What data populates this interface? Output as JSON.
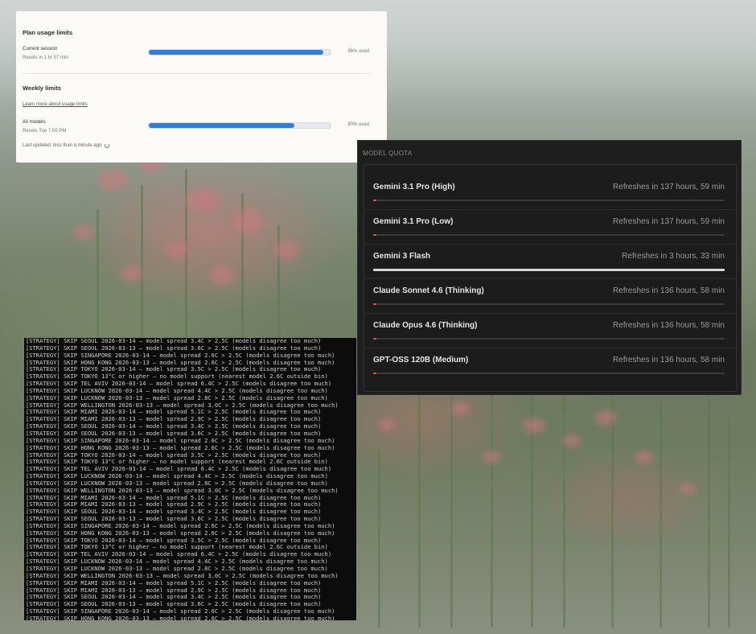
{
  "plan_usage": {
    "title": "Plan usage limits",
    "current_session": {
      "label": "Current session",
      "reset": "Resets in 1 hr 57 min",
      "percent": 96,
      "percent_text": "96% used"
    },
    "weekly_title": "Weekly limits",
    "learn_more": "Learn more about usage limits",
    "all_models": {
      "label": "All models",
      "reset": "Resets Tue 7:00 PM",
      "percent": 80,
      "percent_text": "80% used"
    },
    "last_updated": "Last updated: less than a minute ago",
    "bar_color": "#2f7fd8"
  },
  "model_quota": {
    "title": "MODEL QUOTA",
    "models": [
      {
        "name": "Gemini 3.1 Pro (High)",
        "refresh": "Refreshes in 137 hours, 59 min",
        "remaining": 0.01,
        "color": "#e05a4f"
      },
      {
        "name": "Gemini 3.1 Pro (Low)",
        "refresh": "Refreshes in 137 hours, 59 min",
        "remaining": 0.01,
        "color": "#e05a4f"
      },
      {
        "name": "Gemini 3 Flash",
        "refresh": "Refreshes in 3 hours, 33 min",
        "remaining": 1.0,
        "color": "#d8d8d8"
      },
      {
        "name": "Claude Sonnet 4.6 (Thinking)",
        "refresh": "Refreshes in 136 hours, 58 min",
        "remaining": 0.01,
        "color": "#e05a4f"
      },
      {
        "name": "Claude Opus 4.6 (Thinking)",
        "refresh": "Refreshes in 136 hours, 58 min",
        "remaining": 0.01,
        "color": "#e05a4f"
      },
      {
        "name": "GPT-OSS 120B (Medium)",
        "refresh": "Refreshes in 136 hours, 58 min",
        "remaining": 0.01,
        "color": "#e05a4f"
      }
    ]
  },
  "terminal": {
    "lines": [
      "[STRATEGY] SKIP SEOUL 2026-03-14 — model spread 3.4C > 2.5C (models disagree too much)",
      "[STRATEGY] SKIP SEOUL 2026-03-13 — model spread 3.6C > 2.5C (models disagree too much)",
      "[STRATEGY] SKIP SINGAPORE 2026-03-14 — model spread 2.6C > 2.5C (models disagree too much)",
      "[STRATEGY] SKIP HONG KONG 2026-03-13 — model spread 2.6C > 2.5C (models disagree too much)",
      "[STRATEGY] SKIP TOKYO 2026-03-14 — model spread 3.5C > 2.5C (models disagree too much)",
      "[STRATEGY] SKIP TOKYO 13°C or higher — no model support (nearest model 2.6C outside bin)",
      "[STRATEGY] SKIP TEL AVIV 2026-03-14 — model spread 6.4C > 2.5C (models disagree too much)",
      "[STRATEGY] SKIP LUCKNOW 2026-03-14 — model spread 4.4C > 2.5C (models disagree too much)",
      "[STRATEGY] SKIP LUCKNOW 2026-03-13 — model spread 2.8C > 2.5C (models disagree too much)",
      "[STRATEGY] SKIP WELLINGTON 2026-03-13 — model spread 3.0C > 2.5C (models disagree too much)",
      "[STRATEGY] SKIP MIAMI 2026-03-14 — model spread 5.1C > 2.5C (models disagree too much)",
      "[STRATEGY] SKIP MIAMI 2026-03-13 — model spread 2.9C > 2.5C (models disagree too much)",
      "[STRATEGY] SKIP SEOUL 2026-03-14 — model spread 3.4C > 2.5C (models disagree too much)",
      "[STRATEGY] SKIP SEOUL 2026-03-13 — model spread 3.6C > 2.5C (models disagree too much)",
      "[STRATEGY] SKIP SINGAPORE 2026-03-14 — model spread 2.6C > 2.5C (models disagree too much)",
      "[STRATEGY] SKIP HONG KONG 2026-03-13 — model spread 2.6C > 2.5C (models disagree too much)",
      "[STRATEGY] SKIP TOKYO 2026-03-14 — model spread 3.5C > 2.5C (models disagree too much)",
      "[STRATEGY] SKIP TOKYO 13°C or higher — no model support (nearest model 2.6C outside bin)",
      "[STRATEGY] SKIP TEL AVIV 2026-03-14 — model spread 6.4C > 2.5C (models disagree too much)",
      "[STRATEGY] SKIP LUCKNOW 2026-03-14 — model spread 4.4C > 2.5C (models disagree too much)",
      "[STRATEGY] SKIP LUCKNOW 2026-03-13 — model spread 2.8C > 2.5C (models disagree too much)",
      "[STRATEGY] SKIP WELLINGTON 2026-03-13 — model spread 3.0C > 2.5C (models disagree too much)",
      "[STRATEGY] SKIP MIAMI 2026-03-14 — model spread 5.1C > 2.5C (models disagree too much)",
      "[STRATEGY] SKIP MIAMI 2026-03-13 — model spread 2.9C > 2.5C (models disagree too much)",
      "[STRATEGY] SKIP SEOUL 2026-03-14 — model spread 3.4C > 2.5C (models disagree too much)",
      "[STRATEGY] SKIP SEOUL 2026-03-13 — model spread 3.6C > 2.5C (models disagree too much)",
      "[STRATEGY] SKIP SINGAPORE 2026-03-14 — model spread 2.6C > 2.5C (models disagree too much)",
      "[STRATEGY] SKIP HONG KONG 2026-03-13 — model spread 2.6C > 2.5C (models disagree too much)",
      "[STRATEGY] SKIP TOKYO 2026-03-14 — model spread 3.5C > 2.5C (models disagree too much)",
      "[STRATEGY] SKIP TOKYO 13°C or higher — no model support (nearest model 2.6C outside bin)",
      "[STRATEGY] SKIP TEL AVIV 2026-03-14 — model spread 6.4C > 2.5C (models disagree too much)",
      "[STRATEGY] SKIP LUCKNOW 2026-03-14 — model spread 4.4C > 2.5C (models disagree too much)",
      "[STRATEGY] SKIP LUCKNOW 2026-03-13 — model spread 2.8C > 2.5C (models disagree too much)",
      "[STRATEGY] SKIP WELLINGTON 2026-03-13 — model spread 3.0C > 2.5C (models disagree too much)",
      "[STRATEGY] SKIP MIAMI 2026-03-14 — model spread 5.1C > 2.5C (models disagree too much)",
      "[STRATEGY] SKIP MIAMI 2026-03-13 — model spread 2.9C > 2.5C (models disagree too much)",
      "[STRATEGY] SKIP SEOUL 2026-03-14 — model spread 3.4C > 2.5C (models disagree too much)",
      "[STRATEGY] SKIP SEOUL 2026-03-13 — model spread 3.6C > 2.5C (models disagree too much)",
      "[STRATEGY] SKIP SINGAPORE 2026-03-14 — model spread 2.6C > 2.5C (models disagree too much)",
      "[STRATEGY] SKIP HONG KONG 2026-03-13 — model spread 2.6C > 2.5C (models disagree too much)"
    ]
  }
}
